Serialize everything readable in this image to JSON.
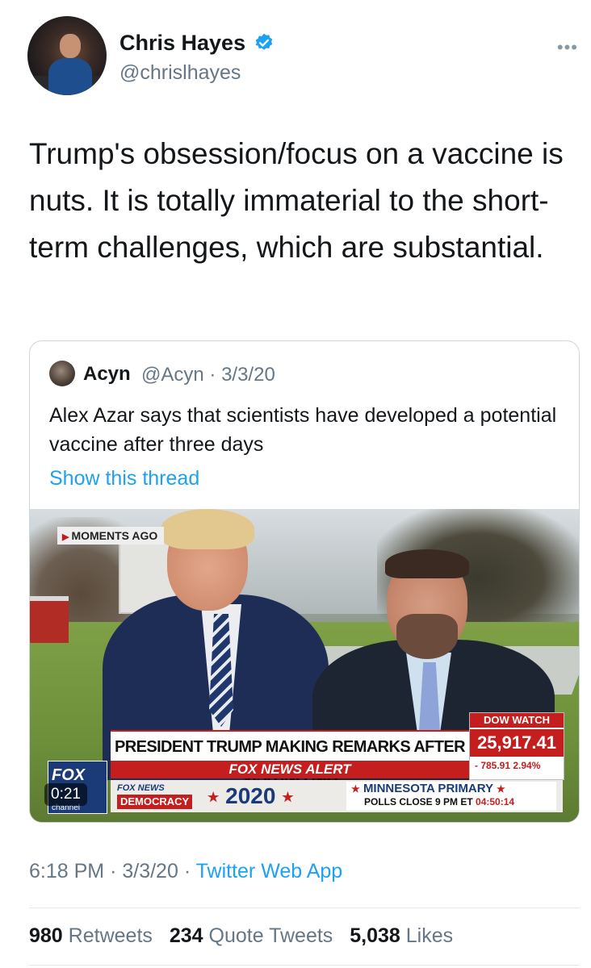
{
  "author": {
    "display_name": "Chris Hayes",
    "handle": "@chrislhayes",
    "verified": true
  },
  "tweet": {
    "text": "Trump's obsession/focus on a vaccine is nuts. It is totally immaterial to the short-term challenges, which are substantial.",
    "time": "6:18 PM",
    "date": "3/3/20",
    "source": "Twitter Web App",
    "separator": "·"
  },
  "quote": {
    "name": "Acyn",
    "handle": "@Acyn",
    "date": "3/3/20",
    "text": "Alex Azar says that scientists have developed a potential vaccine after three days",
    "show_thread": "Show this thread"
  },
  "video": {
    "moments_tag": "MOMENTS AGO",
    "headline": "PRESIDENT TRUMP MAKING REMARKS AFTER VISITING NIH",
    "alert": "FOX NEWS ALERT",
    "dow_label": "DOW WATCH",
    "dow_value": "25,917.41",
    "dow_change": "- 785.91 2.94%",
    "fox_logo": "FOX",
    "fox_channel": "channel",
    "democracy_top": "FOX NEWS",
    "democracy_bottom": "DEMOCRACY",
    "year": "2020",
    "primary_title": "MINNESOTA PRIMARY",
    "polls_close": "POLLS CLOSE 9 PM ET",
    "countdown": "04:50:14",
    "elapsed": "0:21"
  },
  "stats": {
    "retweets_count": "980",
    "retweets_label": "Retweets",
    "quotes_count": "234",
    "quotes_label": "Quote Tweets",
    "likes_count": "5,038",
    "likes_label": "Likes"
  },
  "icons": {
    "verified": "verified-badge-icon",
    "more": "more-options-icon"
  },
  "colors": {
    "link_blue": "#1da1f2",
    "text_secondary": "#657786",
    "fox_red": "#c41e1e",
    "fox_blue": "#1a3a78"
  }
}
